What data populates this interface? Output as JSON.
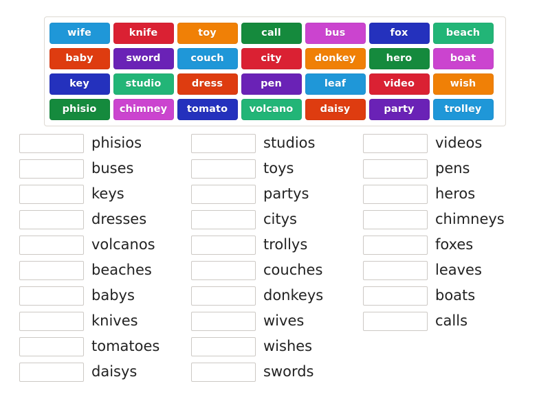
{
  "activity": {
    "type": "drag-and-drop-matching",
    "tile_bank_rows": 4,
    "tile_bank_columns": 7,
    "answer_columns": 3
  },
  "tile_bank": {
    "rows": [
      [
        {
          "label": "wife",
          "color": "#1f97d8"
        },
        {
          "label": "knife",
          "color": "#da2133"
        },
        {
          "label": "toy",
          "color": "#f08006"
        },
        {
          "label": "call",
          "color": "#158a3d"
        },
        {
          "label": "bus",
          "color": "#cb44cf"
        },
        {
          "label": "fox",
          "color": "#2431bd"
        },
        {
          "label": "beach",
          "color": "#22b577"
        }
      ],
      [
        {
          "label": "baby",
          "color": "#de3c10"
        },
        {
          "label": "sword",
          "color": "#6a22b6"
        },
        {
          "label": "couch",
          "color": "#1f97d8"
        },
        {
          "label": "city",
          "color": "#da2133"
        },
        {
          "label": "donkey",
          "color": "#f08006"
        },
        {
          "label": "hero",
          "color": "#158a3d"
        },
        {
          "label": "boat",
          "color": "#cb44cf"
        }
      ],
      [
        {
          "label": "key",
          "color": "#2431bd"
        },
        {
          "label": "studio",
          "color": "#22b577"
        },
        {
          "label": "dress",
          "color": "#de3c10"
        },
        {
          "label": "pen",
          "color": "#6a22b6"
        },
        {
          "label": "leaf",
          "color": "#1f97d8"
        },
        {
          "label": "video",
          "color": "#da2133"
        },
        {
          "label": "wish",
          "color": "#f08006"
        }
      ],
      [
        {
          "label": "phisio",
          "color": "#158a3d"
        },
        {
          "label": "chimney",
          "color": "#cb44cf"
        },
        {
          "label": "tomato",
          "color": "#2431bd"
        },
        {
          "label": "volcano",
          "color": "#22b577"
        },
        {
          "label": "daisy",
          "color": "#de3c10"
        },
        {
          "label": "party",
          "color": "#6a22b6"
        },
        {
          "label": "trolley",
          "color": "#1f97d8"
        }
      ]
    ]
  },
  "answers": {
    "columns": [
      {
        "items": [
          {
            "label": "phisios"
          },
          {
            "label": "buses"
          },
          {
            "label": "keys"
          },
          {
            "label": "dresses"
          },
          {
            "label": "volcanos"
          },
          {
            "label": "beaches"
          },
          {
            "label": "babys"
          },
          {
            "label": "knives"
          },
          {
            "label": "tomatoes"
          },
          {
            "label": "daisys"
          }
        ]
      },
      {
        "items": [
          {
            "label": "studios"
          },
          {
            "label": "toys"
          },
          {
            "label": "partys"
          },
          {
            "label": "citys"
          },
          {
            "label": "trollys"
          },
          {
            "label": "couches"
          },
          {
            "label": "donkeys"
          },
          {
            "label": "wives"
          },
          {
            "label": "wishes"
          },
          {
            "label": "swords"
          }
        ]
      },
      {
        "items": [
          {
            "label": "videos"
          },
          {
            "label": "pens"
          },
          {
            "label": "heros"
          },
          {
            "label": "chimneys"
          },
          {
            "label": "foxes"
          },
          {
            "label": "leaves"
          },
          {
            "label": "boats"
          },
          {
            "label": "calls"
          }
        ]
      }
    ]
  },
  "theme": {
    "page_background": "#ffffff",
    "bank_border": "#ddd9d2",
    "slot_border": "#ccc8c4",
    "text_color": "#222222",
    "tile_text_color": "#ffffff"
  }
}
